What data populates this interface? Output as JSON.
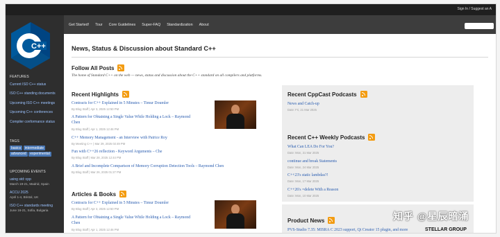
{
  "topbar": {
    "login": "Sign In / Suggest an A"
  },
  "nav": {
    "links": [
      "Get Started!",
      "Tour",
      "Core Guidelines",
      "Super-FAQ",
      "Standardization",
      "About"
    ]
  },
  "logo": {
    "text": "C++"
  },
  "sidebar": {
    "features_title": "FEATURES",
    "features": [
      "Current ISO C++ status",
      "ISO C++ standing documents",
      "Upcoming ISO C++ meetings",
      "Upcoming C++ conferences",
      "Compiler conformance status"
    ],
    "tags_title": "TAGS",
    "tags": [
      "basics",
      "intermediate",
      "advanced",
      "experimental"
    ],
    "events_title": "UPCOMING EVENTS",
    "events": [
      {
        "name": "using std::cpp",
        "detail": "March 19-21, Madrid, Spain"
      },
      {
        "name": "ACCU 2025",
        "detail": "April 1-4, Bristol, UK"
      },
      {
        "name": "ISO C++ standards meeting",
        "detail": "June 16-21, Sofia, Bulgaria"
      }
    ]
  },
  "main": {
    "title": "News, Status & Discussion about Standard C++",
    "follow_title": "Follow All Posts",
    "intro": "The home of Standard C++ on the web — news, status and discussion about the C++ standard on all compilers and platforms.",
    "highlights_title": "Recent Highlights",
    "highlights": [
      {
        "title": "Contracts for C++ Explained in 5 Minutes – Timur Doumler",
        "meta": "By Blog Staff | Apr 3, 2025 12:50 PM"
      },
      {
        "title": "A Pattern for Obtaining a Single Value While Holding a Lock – Raymond",
        "title2": "Chen",
        "meta": "By Blog Staff | Apr 1, 2025 12:46 PM"
      },
      {
        "title": "C++ Memory Management - an Interview with Patrice Roy",
        "meta": "By Meeting C++ | Mar 29, 2025 02:49 PM"
      },
      {
        "title": "Fun with C++26 reflection - Keyword Arguments – Che",
        "meta": "By Blog Staff | Mar 28, 2025 12:44 PM"
      },
      {
        "title": "A Brief and Incomplete Comparison of Memory Corruption Detection Tools – Raymond Chen",
        "meta": "By Blog Staff | Mar 26, 2025 01:27 PM"
      }
    ],
    "articles_title": "Articles & Books",
    "articles": [
      {
        "title": "Contracts for C++ Explained in 5 Minutes – Timur Doumler",
        "meta": "By Blog Staff | Apr 3, 2025 12:50 PM"
      },
      {
        "title": "A Pattern for Obtaining a Single Value While Holding a Lock – Raymond",
        "title2": "Chen",
        "meta": "By Blog Staff | Apr 1, 2025 12:46 PM"
      }
    ]
  },
  "right": {
    "cppcast_title": "Recent CppCast Podcasts",
    "cppcast": [
      {
        "title": "News and Catch-up",
        "meta": "Date: Fri, 21 Mar 2025"
      }
    ],
    "weekly_title": "Recent C++ Weekly Podcasts",
    "weekly": [
      {
        "title": "What Can LEA Do For You?",
        "meta": "Date: Mon, 31 Mar 2025"
      },
      {
        "title": "continue and break Statements",
        "meta": "Date: Mon, 24 Mar 2025"
      },
      {
        "title": "C++23's static lambdas?!",
        "meta": "Date: Mon, 17 Mar 2025"
      },
      {
        "title": "C++26's =delete With a Reason",
        "meta": "Date: Mon, 10 Mar 2025"
      }
    ],
    "product_title": "Product News",
    "product": [
      {
        "title": "PVS-Studio 7.35: MISRA C 2023 support, Qt Creator 15 plugin, and more"
      }
    ]
  },
  "watermark": "知乎 @星辰暗涌",
  "brand": "STELLAR GROUP"
}
